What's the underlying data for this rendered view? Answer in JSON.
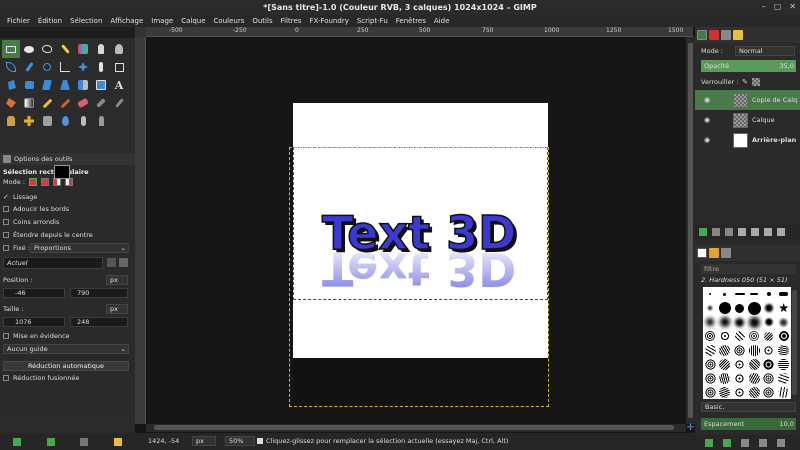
{
  "window": {
    "title": "*[Sans titre]-1.0 (Couleur RVB, 3 calques) 1024x1024 – GIMP",
    "controls": [
      "–",
      "▢",
      "✕"
    ]
  },
  "menu": [
    "Fichier",
    "Édition",
    "Sélection",
    "Affichage",
    "Image",
    "Calque",
    "Couleurs",
    "Outils",
    "Filtres",
    "FX-Foundry",
    "Script-Fu",
    "Fenêtres",
    "Aide"
  ],
  "ruler": {
    "h_ticks": [
      "-500",
      "-250",
      "0",
      "250",
      "500",
      "750",
      "1000",
      "1250",
      "1500"
    ]
  },
  "canvas": {
    "text": "Text 3D",
    "text_color": "#3a3ad0",
    "reflection_color": "#7070e0"
  },
  "tool_options": {
    "tab_label": "Options des outils",
    "title": "Sélection rectangulaire",
    "mode_label": "Mode :",
    "lissage": "Lissage",
    "adoucir": "Adoucir les bords",
    "coins": "Coins arrondis",
    "etendre": "Étendre depuis le centre",
    "fixe_label": "Fixé :",
    "fixe_value": "Proportions",
    "actuel": "Actuel",
    "position_label": "Position :",
    "position_unit": "px",
    "pos_x": "-46",
    "pos_y": "790",
    "taille_label": "Taille :",
    "taille_unit": "px",
    "size_w": "1076",
    "size_h": "248",
    "mise_en_evidence": "Mise en évidence",
    "guide": "Aucun guide",
    "reduction_auto": "Réduction automatique",
    "reduction_fusionnee": "Réduction fusionnée"
  },
  "status": {
    "coords": "1424, -54",
    "unit": "px",
    "zoom": "50%",
    "message": "Cliquez-glissez pour remplacer la sélection actuelle (essayez Maj, Ctrl, Alt)"
  },
  "layers": {
    "mode_label": "Mode :",
    "mode_value": "Normal",
    "opacity_label": "Opacité",
    "opacity_value": "35,0",
    "lock_label": "Verrouiller :",
    "items": [
      {
        "name": "Copie de Calq",
        "selected": true
      },
      {
        "name": "Calque",
        "selected": false
      },
      {
        "name": "Arrière-plan",
        "selected": false
      }
    ]
  },
  "brushes": {
    "filter": "filtre",
    "current": "2. Hardness 050 (51 × 51)",
    "preset": "Basic,",
    "spacing_label": "Espacement",
    "spacing_value": "10,0"
  }
}
